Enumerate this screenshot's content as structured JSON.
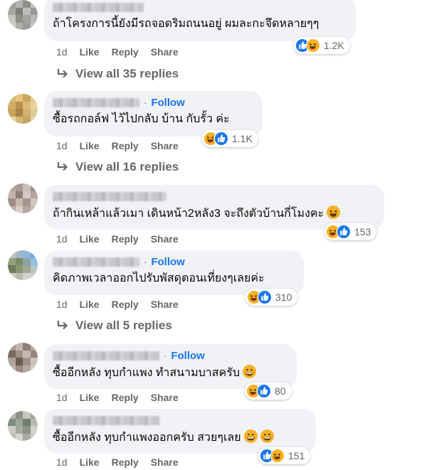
{
  "comments": [
    {
      "text": "ถ้าโครงการนี้ยังมีรถจอดริมถนนอยู่ ผมละกะจึดหลายๆๆ",
      "follow": "",
      "time": "1d",
      "like": "Like",
      "reply": "Reply",
      "share": "Share",
      "reaction_count": "1.2K",
      "reactions": [
        "like",
        "haha"
      ],
      "view_replies": "View all 35 replies"
    },
    {
      "text": "ซื้อรถกอล์ฟ ไว้ไปกลับ บ้าน กับรั้ว ค่ะ",
      "follow": "Follow",
      "time": "1d",
      "like": "Like",
      "reply": "Reply",
      "share": "Share",
      "reaction_count": "1.1K",
      "reactions": [
        "haha",
        "like"
      ],
      "view_replies": "View all 16 replies"
    },
    {
      "text": "ถ้ากินเหล้าแล้วเมา เดินหน้า2หลัง3 จะถึงตัวบ้านกี่โมงคะ",
      "follow": "",
      "time": "1d",
      "like": "Like",
      "reply": "Reply",
      "share": "Share",
      "reaction_count": "153",
      "reactions": [
        "haha",
        "like"
      ],
      "view_replies": ""
    },
    {
      "text": "คิดภาพเวลาออกไปรับพัสดุตอนเที่ยงๆเลยค่ะ",
      "follow": "Follow",
      "time": "1d",
      "like": "Like",
      "reply": "Reply",
      "share": "Share",
      "reaction_count": "310",
      "reactions": [
        "haha",
        "like"
      ],
      "view_replies": "View all 5 replies"
    },
    {
      "text": "ซื้ออีกหลัง ทุบกำแพง ทำสนามบาสครับ",
      "follow": "Follow",
      "time": "1d",
      "like": "Like",
      "reply": "Reply",
      "share": "Share",
      "reaction_count": "80",
      "reactions": [
        "haha",
        "like"
      ],
      "view_replies": ""
    },
    {
      "text": "ซื้ออีกหลัง ทุบกำแพงออกครับ สวยๆเลย",
      "follow": "",
      "time": "1d",
      "like": "Like",
      "reply": "Reply",
      "share": "Share",
      "reaction_count": "151",
      "reactions": [
        "like",
        "haha"
      ],
      "view_replies": ""
    }
  ],
  "separator": "·",
  "colors": {
    "accent": "#1877f2",
    "muted": "#65676b",
    "bubble": "#f0f2f5",
    "haha": "#f7b125"
  }
}
